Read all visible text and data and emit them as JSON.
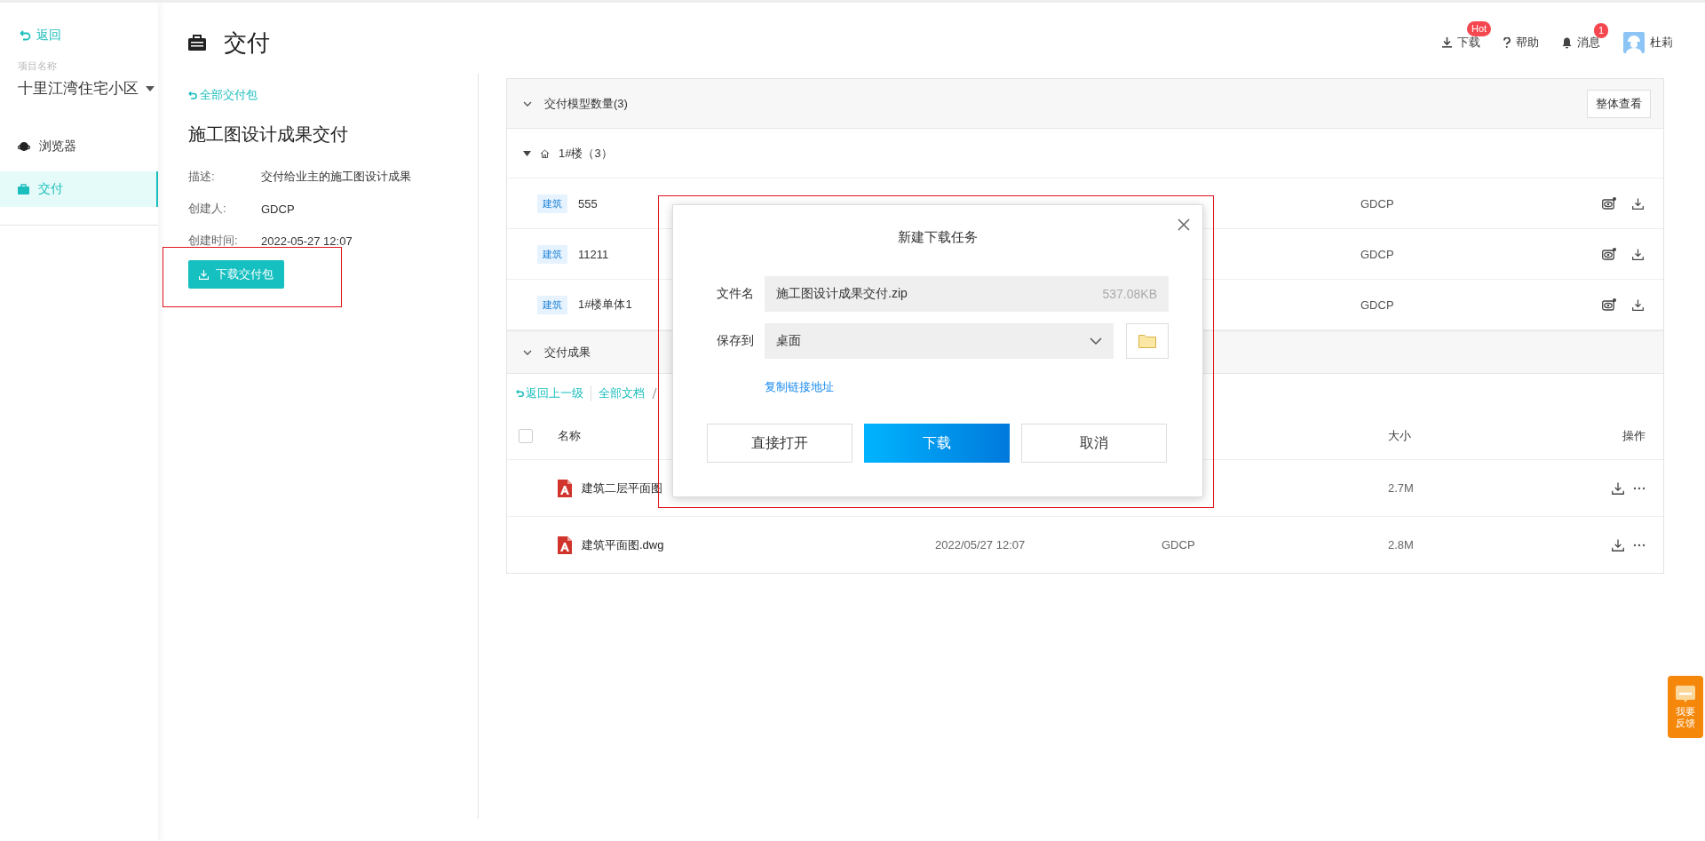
{
  "sidebar": {
    "back": "返回",
    "project_label": "项目名称",
    "project_name": "十里江湾住宅小区",
    "items": [
      {
        "label": "浏览器",
        "selected": false
      },
      {
        "label": "交付",
        "selected": true
      }
    ]
  },
  "header": {
    "title": "交付",
    "actions": [
      {
        "kind": "download",
        "label": "下载",
        "badge": "Hot"
      },
      {
        "kind": "help",
        "label": "帮助"
      },
      {
        "kind": "bell",
        "label": "消息",
        "badge": "1"
      },
      {
        "kind": "user",
        "label": "杜莉"
      }
    ]
  },
  "package": {
    "back_link": "全部交付包",
    "name": "施工图设计成果交付",
    "fields": [
      {
        "label": "描述:",
        "value": "交付给业主的施工图设计成果"
      },
      {
        "label": "创建人:",
        "value": "GDCP"
      },
      {
        "label": "创建时间:",
        "value": "2022-05-27 12:07"
      }
    ],
    "download_button": "下载交付包"
  },
  "models": {
    "title": "交付模型数量(3)",
    "expanded": true,
    "view_all_button": "整体查看",
    "groups": [
      {
        "name": "1#楼（3）",
        "expanded": true,
        "rows": [
          {
            "tag": "建筑",
            "name": "555",
            "creator": "GDCP"
          },
          {
            "tag": "建筑",
            "name": "11211",
            "creator": "GDCP"
          },
          {
            "tag": "建筑",
            "name": "1#楼单体1",
            "creator": "GDCP"
          }
        ]
      }
    ]
  },
  "results": {
    "title": "交付成果",
    "expanded": true,
    "breadcrumb": {
      "back": "返回上一级",
      "items": [
        "全部文档"
      ]
    },
    "header": {
      "checked": false,
      "name": "名称",
      "size": "大小",
      "actions": "操作"
    },
    "rows": [
      {
        "name": "建筑二层平面图",
        "size": "2.7M"
      },
      {
        "name": "建筑平面图.dwg",
        "date": "2022/05/27 12:07",
        "creator": "GDCP",
        "size": "2.8M"
      }
    ]
  },
  "dialog": {
    "title": "新建下载任务",
    "file_label": "文件名",
    "file_name": "施工图设计成果交付.zip",
    "file_size": "537.08KB",
    "save_label": "保存到",
    "save_value": "桌面",
    "copy_link": "复制链接地址",
    "buttons": [
      {
        "kind": "secondary",
        "label": "直接打开"
      },
      {
        "kind": "primary",
        "label": "下载"
      },
      {
        "kind": "secondary",
        "label": "取消"
      }
    ]
  },
  "feedback": {
    "label": "我要反馈"
  }
}
